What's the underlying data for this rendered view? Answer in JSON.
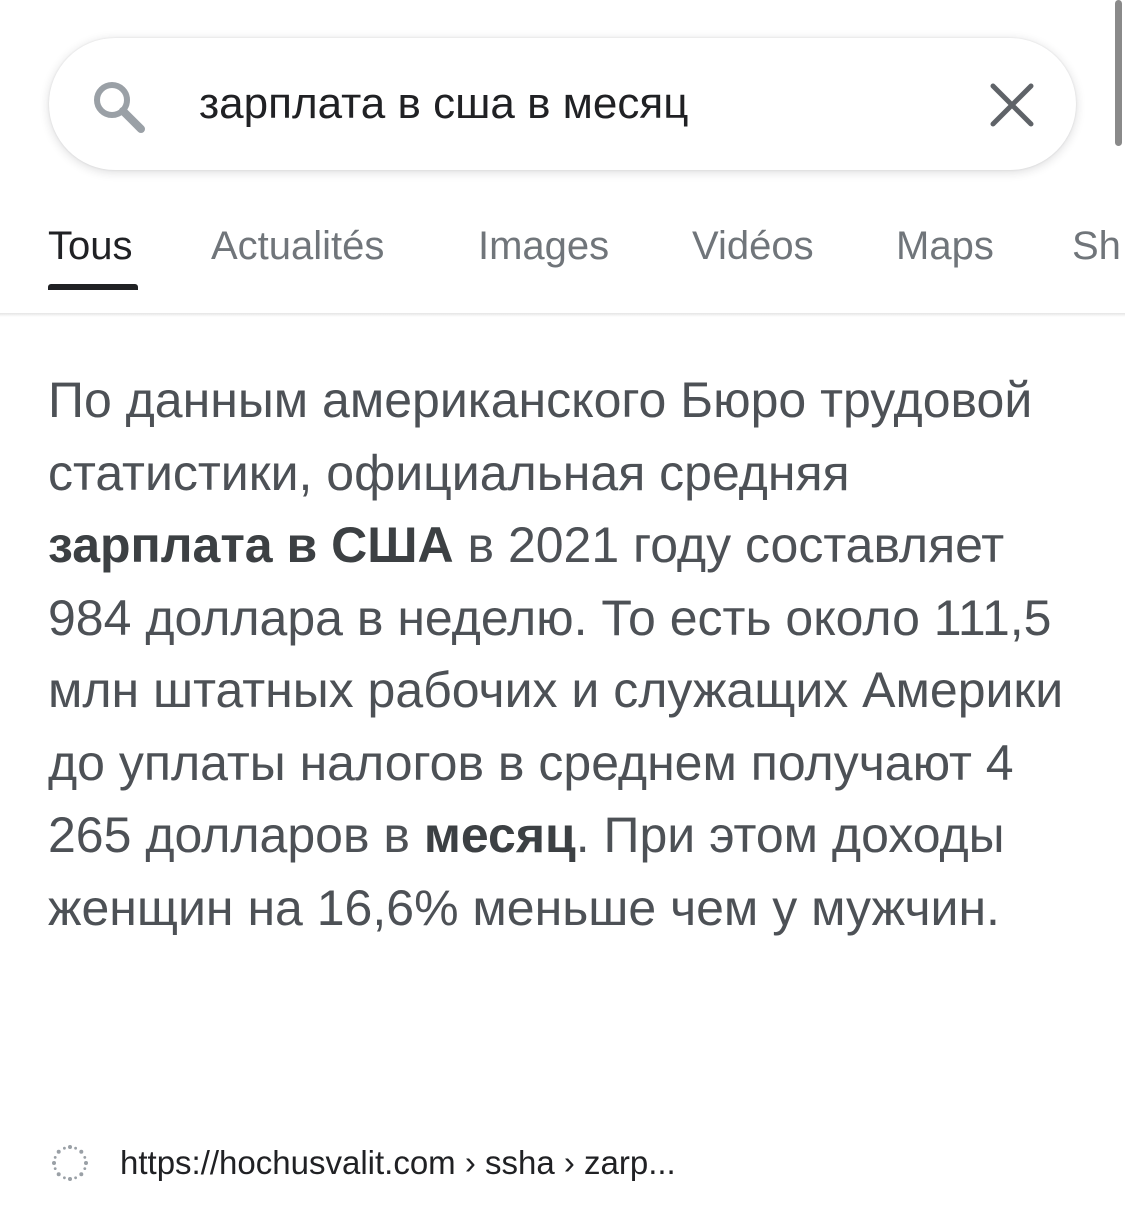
{
  "search": {
    "query": "зарплата в сша в месяц"
  },
  "tabs": [
    {
      "label": "Tous",
      "active": true
    },
    {
      "label": "Actualités",
      "active": false
    },
    {
      "label": "Images",
      "active": false
    },
    {
      "label": "Vidéos",
      "active": false
    },
    {
      "label": "Maps",
      "active": false
    },
    {
      "label": "Sh",
      "active": false
    }
  ],
  "snippet": {
    "part1": "По данным американского Бюро трудовой статистики, официальная средняя ",
    "bold1": "зарплата в США",
    "part2": " в 2021 году составляет 984 доллара в неделю. То есть около 111,5 млн штатных рабочих и служащих Америки до уплаты налогов в среднем получают 4 265 долларов в ",
    "bold2": "месяц",
    "part3": ". При этом доходы женщин на 16,6% меньше чем у мужчин."
  },
  "source": {
    "url_display": "https://hochusvalit.com › ssha › zarp..."
  },
  "colors": {
    "active_tab": "#202124",
    "inactive_tab": "#70757a",
    "snippet_text": "#4d5156"
  }
}
